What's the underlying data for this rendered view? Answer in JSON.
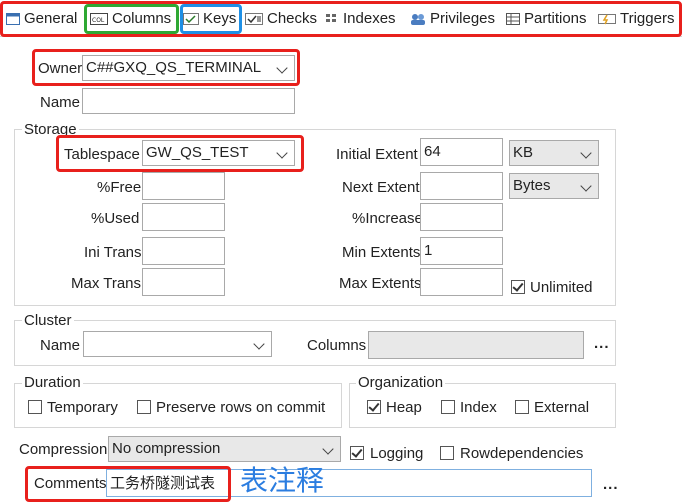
{
  "tabs": [
    {
      "label": "General",
      "icon": "general-icon"
    },
    {
      "label": "Columns",
      "icon": "columns-icon"
    },
    {
      "label": "Keys",
      "icon": "keys-icon"
    },
    {
      "label": "Checks",
      "icon": "checks-icon"
    },
    {
      "label": "Indexes",
      "icon": "indexes-icon"
    },
    {
      "label": "Privileges",
      "icon": "privileges-icon"
    },
    {
      "label": "Partitions",
      "icon": "partitions-icon"
    },
    {
      "label": "Triggers",
      "icon": "triggers-icon"
    }
  ],
  "general": {
    "owner_label": "Owner",
    "owner_value": "C##GXQ_QS_TERMINAL",
    "name_label": "Name",
    "name_value": ""
  },
  "storage": {
    "title": "Storage",
    "tablespace_label": "Tablespace",
    "tablespace_value": "GW_QS_TEST",
    "free_label": "%Free",
    "free_value": "",
    "used_label": "%Used",
    "used_value": "",
    "ini_trans_label": "Ini Trans",
    "ini_trans_value": "",
    "max_trans_label": "Max Trans",
    "max_trans_value": "",
    "initial_extent_label": "Initial Extent",
    "initial_extent_value": "64",
    "initial_extent_unit": "KB",
    "next_extent_label": "Next Extent",
    "next_extent_value": "",
    "next_extent_unit": "Bytes",
    "increase_label": "%Increase",
    "increase_value": "",
    "min_extents_label": "Min Extents",
    "min_extents_value": "1",
    "max_extents_label": "Max Extents",
    "max_extents_value": "",
    "unlimited_label": "Unlimited",
    "unlimited_checked": true
  },
  "cluster": {
    "title": "Cluster",
    "name_label": "Name",
    "name_value": "",
    "columns_label": "Columns",
    "columns_value": "",
    "ellipsis": "..."
  },
  "duration": {
    "title": "Duration",
    "temporary_label": "Temporary",
    "preserve_label": "Preserve rows on commit"
  },
  "organization": {
    "title": "Organization",
    "heap_label": "Heap",
    "index_label": "Index",
    "external_label": "External"
  },
  "compression": {
    "label": "Compression",
    "value": "No compression",
    "logging_label": "Logging",
    "rowdep_label": "Rowdependencies"
  },
  "comments": {
    "label": "Comments",
    "value": "工务桥隧测试表",
    "annotation": "表注释",
    "ellipsis": "..."
  },
  "colors": {
    "highlight_red": "#e8201c",
    "highlight_green": "#2fa833",
    "highlight_blue": "#1e90e6",
    "annotation_blue": "#2b7de0"
  }
}
